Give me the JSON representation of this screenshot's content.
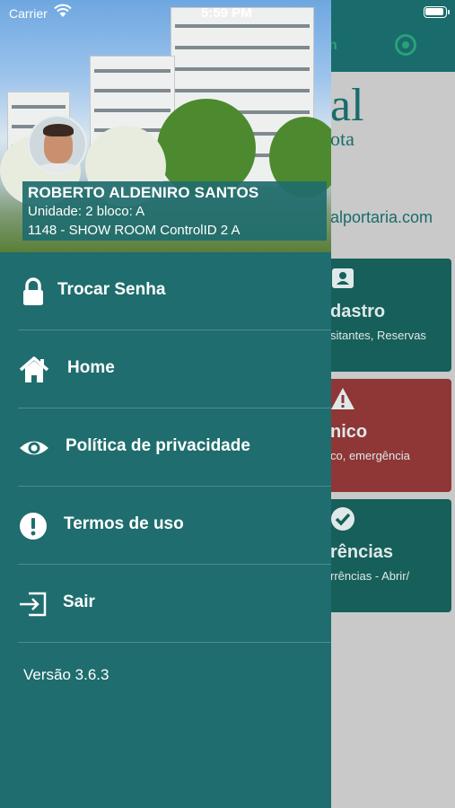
{
  "status_bar": {
    "carrier": "Carrier",
    "time": "5:59 PM"
  },
  "user": {
    "name": "ROBERTO ALDENIRO SANTOS",
    "unit": "Unidade: 2 bloco: A",
    "condo": "1148 - SHOW ROOM ControlID 2 A"
  },
  "menu": [
    {
      "label": "Trocar Senha",
      "icon": "lock-icon"
    },
    {
      "label": "Home",
      "icon": "home-icon"
    },
    {
      "label": "Política de privacidade",
      "icon": "eye-icon"
    },
    {
      "label": "Termos de uso",
      "icon": "exclamation-icon"
    },
    {
      "label": "Sair",
      "icon": "sign-out-icon"
    }
  ],
  "version": "Versão 3.6.3",
  "background": {
    "header_letter": "n",
    "logo_text": "al",
    "logo_sub": "ota",
    "email": "alportaria.com",
    "cards": [
      {
        "title": "dastro",
        "subtitle": "sitantes, Reservas",
        "icon": "id-card-icon",
        "color": "#175f5a"
      },
      {
        "title": "nico",
        "subtitle": "co, emergência",
        "icon": "warning-icon",
        "color": "#8f3636"
      },
      {
        "title": "rências",
        "subtitle": "rrências - Abrir/",
        "icon": "check-circle-icon",
        "color": "#175f5a"
      }
    ]
  }
}
